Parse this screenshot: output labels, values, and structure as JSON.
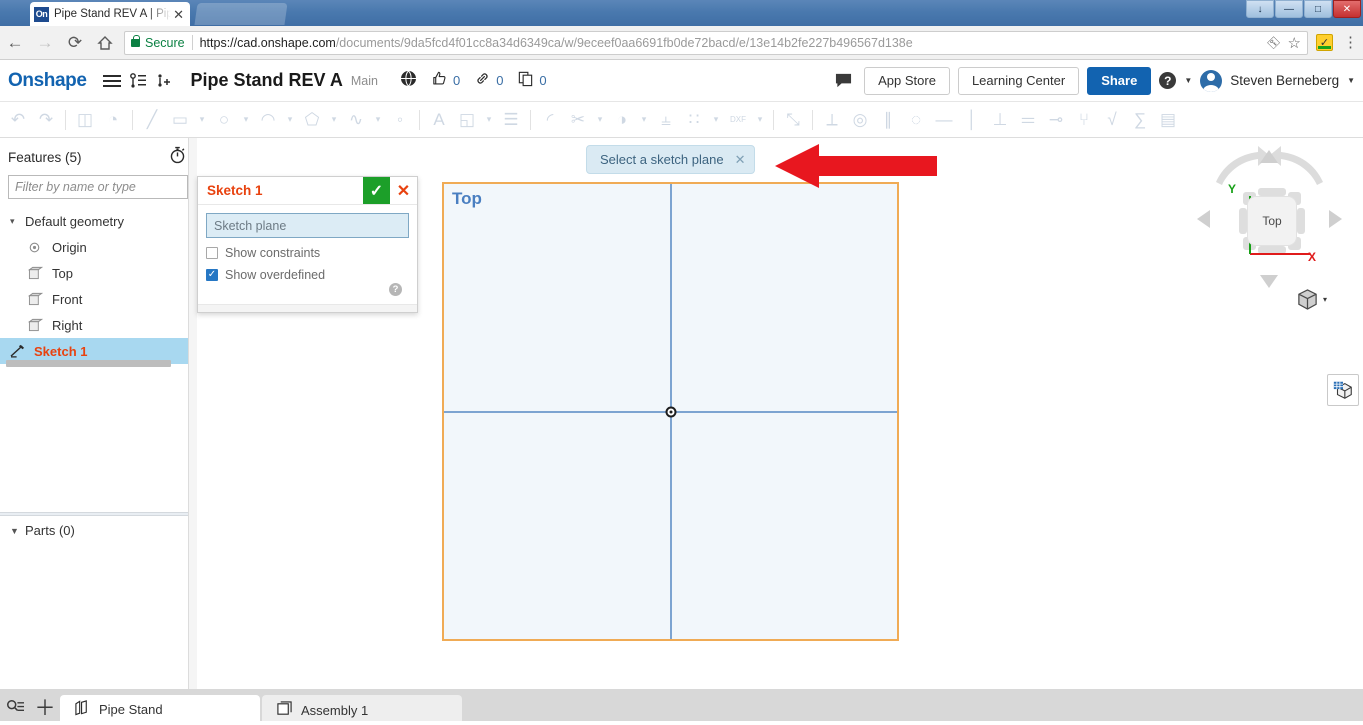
{
  "browser": {
    "tab": {
      "title": "Pipe Stand REV A | Pipe S",
      "favicon_text": "On",
      "close_icon": "close-icon"
    },
    "nav": {
      "back": "←",
      "forward": "→",
      "reload": "⟳",
      "home": "⌂"
    },
    "omnibox": {
      "secure_label": "Secure",
      "url_host": "https://cad.onshape.com",
      "url_path": "/documents/9da5fcd4f01cc8a34d6349ca/w/9eceef0aa6691fb0de72bacd/e/13e14b2fe227b496567d138e",
      "key_icon": "key-icon",
      "star_icon": "bookmark-star-icon",
      "extension_icon": "extension-badge-icon",
      "menu_icon": "chrome-menu-icon"
    },
    "window_controls": {
      "minimize": "—",
      "maximize": "□",
      "close": "✕",
      "extra": "↓"
    }
  },
  "header": {
    "logo": "Onshape",
    "menu_icon": "hamburger-menu-icon",
    "versions_icon": "version-graph-icon",
    "insert_icon": "add-version-icon",
    "document_title": "Pipe Stand REV A",
    "branch": "Main",
    "public_icon": "globe-public-icon",
    "like_icon": "thumbs-up-icon",
    "like_count": "0",
    "link_icon": "link-icon",
    "link_count": "0",
    "copy_icon": "copy-icon",
    "copy_count": "0",
    "comment_icon": "comment-bubble-icon",
    "app_store": "App Store",
    "learning_center": "Learning Center",
    "share": "Share",
    "help_icon": "help-question-icon",
    "user_name": "Steven Berneberg",
    "avatar_icon": "user-avatar"
  },
  "toolbar": {
    "items": [
      {
        "name": "undo-icon",
        "glyph": "↶",
        "type": "icon"
      },
      {
        "name": "redo-icon",
        "glyph": "↷",
        "type": "icon"
      },
      {
        "name": "separator",
        "type": "sep"
      },
      {
        "name": "new-sketch-icon",
        "glyph": "◫",
        "type": "icon"
      },
      {
        "name": "measure-icon",
        "glyph": "◔",
        "type": "icon"
      },
      {
        "name": "separator",
        "type": "sep"
      },
      {
        "name": "line-tool-icon",
        "glyph": "╱",
        "type": "icon"
      },
      {
        "name": "rectangle-tool-icon",
        "glyph": "▭",
        "type": "icon"
      },
      {
        "name": "rectangle-dropdown",
        "type": "caret"
      },
      {
        "name": "circle-tool-icon",
        "glyph": "○",
        "type": "icon"
      },
      {
        "name": "circle-dropdown",
        "type": "caret"
      },
      {
        "name": "arc-tool-icon",
        "glyph": "◠",
        "type": "icon"
      },
      {
        "name": "arc-dropdown",
        "type": "caret"
      },
      {
        "name": "polygon-tool-icon",
        "glyph": "⬠",
        "type": "icon"
      },
      {
        "name": "polygon-dropdown",
        "type": "caret"
      },
      {
        "name": "spline-tool-icon",
        "glyph": "∿",
        "type": "icon"
      },
      {
        "name": "spline-dropdown",
        "type": "caret"
      },
      {
        "name": "point-tool-icon",
        "glyph": "◦",
        "type": "icon"
      },
      {
        "name": "separator",
        "type": "sep"
      },
      {
        "name": "text-tool-icon",
        "glyph": "A",
        "type": "icon"
      },
      {
        "name": "offset-tool-icon",
        "glyph": "◱",
        "type": "icon"
      },
      {
        "name": "offset-dropdown",
        "type": "caret"
      },
      {
        "name": "dimension-tool-icon",
        "glyph": "☰",
        "type": "icon"
      },
      {
        "name": "separator",
        "type": "sep"
      },
      {
        "name": "fillet-tool-icon",
        "glyph": "◜",
        "type": "icon"
      },
      {
        "name": "trim-tool-icon",
        "glyph": "✂",
        "type": "icon"
      },
      {
        "name": "trim-dropdown",
        "type": "caret"
      },
      {
        "name": "mirror-tool-icon",
        "glyph": "◑",
        "type": "icon"
      },
      {
        "name": "mirror-dropdown",
        "type": "caret"
      },
      {
        "name": "transform-tool-icon",
        "glyph": "⫨",
        "type": "icon"
      },
      {
        "name": "pattern-tool-icon",
        "glyph": "∷",
        "type": "icon"
      },
      {
        "name": "pattern-dropdown",
        "type": "caret"
      },
      {
        "name": "import-dxf-icon",
        "glyph": "DXF",
        "type": "icon"
      },
      {
        "name": "import-dropdown",
        "type": "caret"
      },
      {
        "name": "separator",
        "type": "sep"
      },
      {
        "name": "construction-toggle-icon",
        "glyph": "⤡",
        "type": "icon"
      },
      {
        "name": "separator",
        "type": "sep"
      },
      {
        "name": "coincident-constraint-icon",
        "glyph": "⟂",
        "type": "icon"
      },
      {
        "name": "concentric-constraint-icon",
        "glyph": "◎",
        "type": "icon"
      },
      {
        "name": "parallel-constraint-icon",
        "glyph": "∥",
        "type": "icon"
      },
      {
        "name": "tangent-constraint-icon",
        "glyph": "◌",
        "type": "icon"
      },
      {
        "name": "horizontal-constraint-icon",
        "glyph": "—",
        "type": "icon"
      },
      {
        "name": "vertical-constraint-icon",
        "glyph": "│",
        "type": "icon"
      },
      {
        "name": "perpendicular-constraint-icon",
        "glyph": "⊥",
        "type": "icon"
      },
      {
        "name": "equal-constraint-icon",
        "glyph": "＝",
        "type": "icon"
      },
      {
        "name": "midpoint-constraint-icon",
        "glyph": "⊸",
        "type": "icon"
      },
      {
        "name": "symmetric-constraint-icon",
        "glyph": "⑂",
        "type": "icon"
      },
      {
        "name": "curvature-constraint-icon",
        "glyph": "√",
        "type": "icon"
      },
      {
        "name": "normal-constraint-icon",
        "glyph": "∑",
        "type": "icon"
      },
      {
        "name": "fix-constraint-icon",
        "glyph": "▤",
        "type": "icon"
      }
    ]
  },
  "left_panel": {
    "features_title": "Features (5)",
    "history_icon": "stopwatch-history-icon",
    "filter_placeholder": "Filter by name or type",
    "tree": [
      {
        "label": "Default geometry",
        "icon": "chevron-down-icon",
        "level": 0,
        "selected": false
      },
      {
        "label": "Origin",
        "icon": "origin-point-icon",
        "level": 1,
        "selected": false
      },
      {
        "label": "Top",
        "icon": "plane-icon",
        "level": 1,
        "selected": false
      },
      {
        "label": "Front",
        "icon": "plane-icon",
        "level": 1,
        "selected": false
      },
      {
        "label": "Right",
        "icon": "plane-icon",
        "level": 1,
        "selected": false
      },
      {
        "label": "Sketch 1",
        "icon": "sketch-icon",
        "level": 0,
        "selected": true
      }
    ],
    "parts_title": "Parts (0)",
    "parts_caret": "chevron-down-icon"
  },
  "sketch_dialog": {
    "title": "Sketch 1",
    "ok_icon": "checkmark-confirm-icon",
    "cancel_icon": "cancel-x-icon",
    "plane_placeholder": "Sketch plane",
    "show_constraints_label": "Show constraints",
    "show_constraints_checked": false,
    "show_overdefined_label": "Show overdefined",
    "show_overdefined_checked": true,
    "help_icon": "help-question-icon"
  },
  "graphics": {
    "tooltip_text": "Select a sketch plane",
    "tooltip_close": "✕",
    "plane_label": "Top",
    "annotation_arrow": "red-pointer-arrow",
    "origin_marker": "origin-point-marker",
    "display_panel_icon": "display-appearance-icon"
  },
  "viewcube": {
    "face_label": "Top",
    "axis_y": "Y",
    "axis_x": "X",
    "home_icon": "view-home-cube-icon",
    "home_caret": "▾",
    "rotate_ccw_icon": "rotate-ccw-arrow-icon",
    "rotate_cw_icon": "rotate-cw-arrow-icon",
    "nav_up_icon": "nav-up-triangle",
    "nav_down_icon": "nav-down-triangle",
    "nav_left_icon": "nav-left-triangle",
    "nav_right_icon": "nav-right-triangle"
  },
  "bottom_bar": {
    "search_icon": "tab-search-icon",
    "add_icon": "＋",
    "tabs": [
      {
        "label": "Pipe Stand",
        "icon": "part-studio-icon",
        "active": true
      },
      {
        "label": "Assembly 1",
        "icon": "assembly-icon",
        "active": false
      }
    ]
  },
  "colors": {
    "onshape_blue": "#1263b0",
    "selection_blue": "#a8d8f0",
    "sketch_orange": "#e8420f",
    "plane_border": "#f0ab55",
    "axis_blue": "#7da4d1",
    "confirm_green": "#1c9f29",
    "annotation_red": "#e8171f"
  }
}
